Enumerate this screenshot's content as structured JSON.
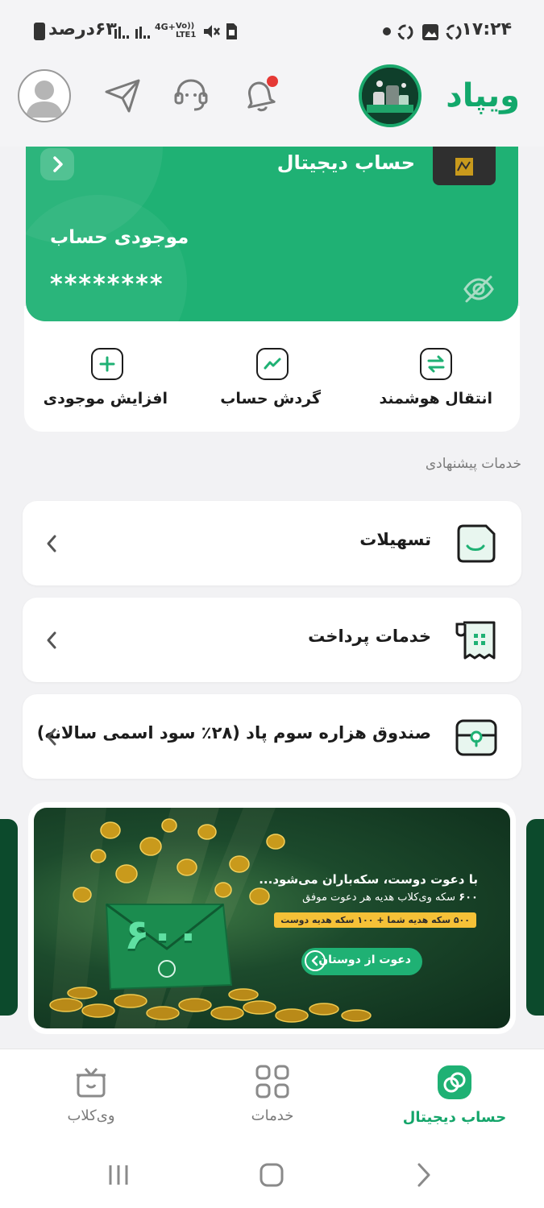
{
  "status_bar": {
    "time": "۱۷:۲۴",
    "battery": "۶۳درصد",
    "network": "4G+",
    "volte": "Vo)) LTE1"
  },
  "header": {
    "brand": "ویپاد",
    "icons": [
      "bell-icon",
      "support-headset-icon",
      "send-icon",
      "profile-avatar"
    ],
    "has_notification_dot": true
  },
  "account_card": {
    "title": "حساب دیجیتال",
    "balance_label": "موجودی حساب",
    "balance_value": "********",
    "actions": [
      {
        "label": "انتقال هوشمند",
        "icon": "transfer-arrows-icon"
      },
      {
        "label": "گردش حساب",
        "icon": "chart-line-icon"
      },
      {
        "label": "افزایش موجودی",
        "icon": "plus-icon"
      }
    ]
  },
  "suggested": {
    "title": "خدمات پیشنهادی",
    "items": [
      {
        "label": "تسهیلات",
        "icon": "loan-icon"
      },
      {
        "label": "خدمات پرداخت",
        "icon": "receipt-icon"
      },
      {
        "label": "صندوق هزاره سوم پاد (۲۸٪ سود اسمی سالانه)",
        "icon": "safe-box-icon"
      }
    ]
  },
  "banner": {
    "title": "با دعوت دوست، سکه‌باران می‌شود...",
    "line1_number": "۶۰۰",
    "line1_text": "سکه وی‌کلاب هدیه هر دعوت موفق",
    "pill": "۵۰۰ سکه هدیه شما + ۱۰۰ سکه هدیه دوست",
    "button": "دعوت از دوستان",
    "big_number": "۶۰۰"
  },
  "bottom_nav": [
    {
      "label": "حساب دیجیتال",
      "icon": "digital-account-icon",
      "active": true
    },
    {
      "label": "خدمات",
      "icon": "grid-icon",
      "active": false
    },
    {
      "label": "وی‌کلاب",
      "icon": "gift-icon",
      "active": false
    }
  ],
  "colors": {
    "accent": "#1fb174",
    "brand": "#12a86b",
    "background": "#f2f2f4",
    "notification": "#e53935"
  }
}
